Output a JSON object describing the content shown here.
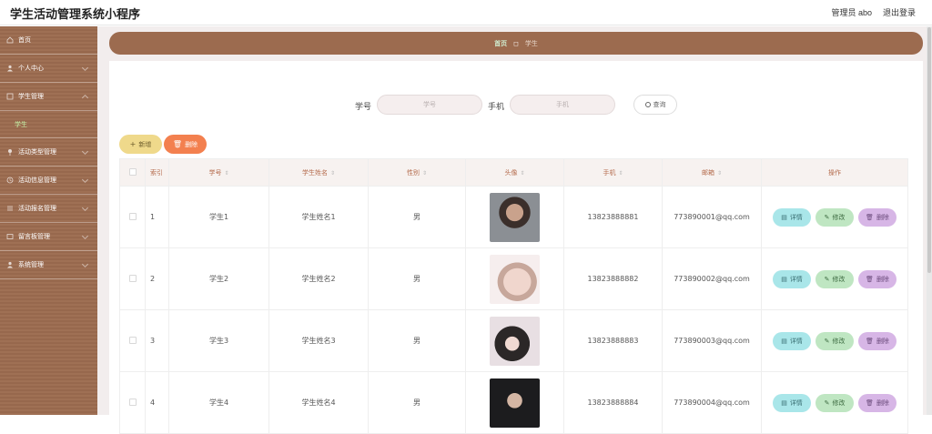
{
  "header": {
    "app_title": "学生活动管理系统小程序",
    "admin_label": "管理员 abo",
    "logout_label": "退出登录"
  },
  "sidebar": {
    "items": [
      {
        "label": "首页",
        "icon": "home-icon"
      },
      {
        "label": "个人中心",
        "icon": "user-icon"
      },
      {
        "label": "学生管理",
        "icon": "list-icon"
      },
      {
        "label": "活动类型管理",
        "icon": "pin-icon"
      },
      {
        "label": "活动信息管理",
        "icon": "clock-icon"
      },
      {
        "label": "活动报名管理",
        "icon": "list-icon"
      },
      {
        "label": "留言板管理",
        "icon": "board-icon"
      },
      {
        "label": "系统管理",
        "icon": "user-icon"
      }
    ],
    "sub_active": "学生"
  },
  "breadcrumb": {
    "home": "首页",
    "current": "学生"
  },
  "search": {
    "student_no_label": "学号",
    "student_no_placeholder": "学号",
    "phone_label": "手机",
    "phone_placeholder": "手机",
    "query_label": "查询"
  },
  "actions": {
    "add_label": "新增",
    "delete_label": "删除"
  },
  "table": {
    "headers": [
      "索引",
      "学号",
      "学生姓名",
      "性别",
      "头像",
      "手机",
      "邮箱",
      "操作"
    ],
    "rows": [
      {
        "index": "1",
        "student_no": "学生1",
        "name": "学生姓名1",
        "gender": "男",
        "phone": "13823888881",
        "email": "773890001@qq.com"
      },
      {
        "index": "2",
        "student_no": "学生2",
        "name": "学生姓名2",
        "gender": "男",
        "phone": "13823888882",
        "email": "773890002@qq.com"
      },
      {
        "index": "3",
        "student_no": "学生3",
        "name": "学生姓名3",
        "gender": "男",
        "phone": "13823888883",
        "email": "773890003@qq.com"
      },
      {
        "index": "4",
        "student_no": "学生4",
        "name": "学生姓名4",
        "gender": "男",
        "phone": "13823888884",
        "email": "773890004@qq.com"
      }
    ],
    "op_labels": {
      "detail": "详情",
      "edit": "修改",
      "delete": "删除"
    }
  },
  "colors": {
    "brand": "#9c6b4f",
    "accent_text": "#b46b4c"
  }
}
